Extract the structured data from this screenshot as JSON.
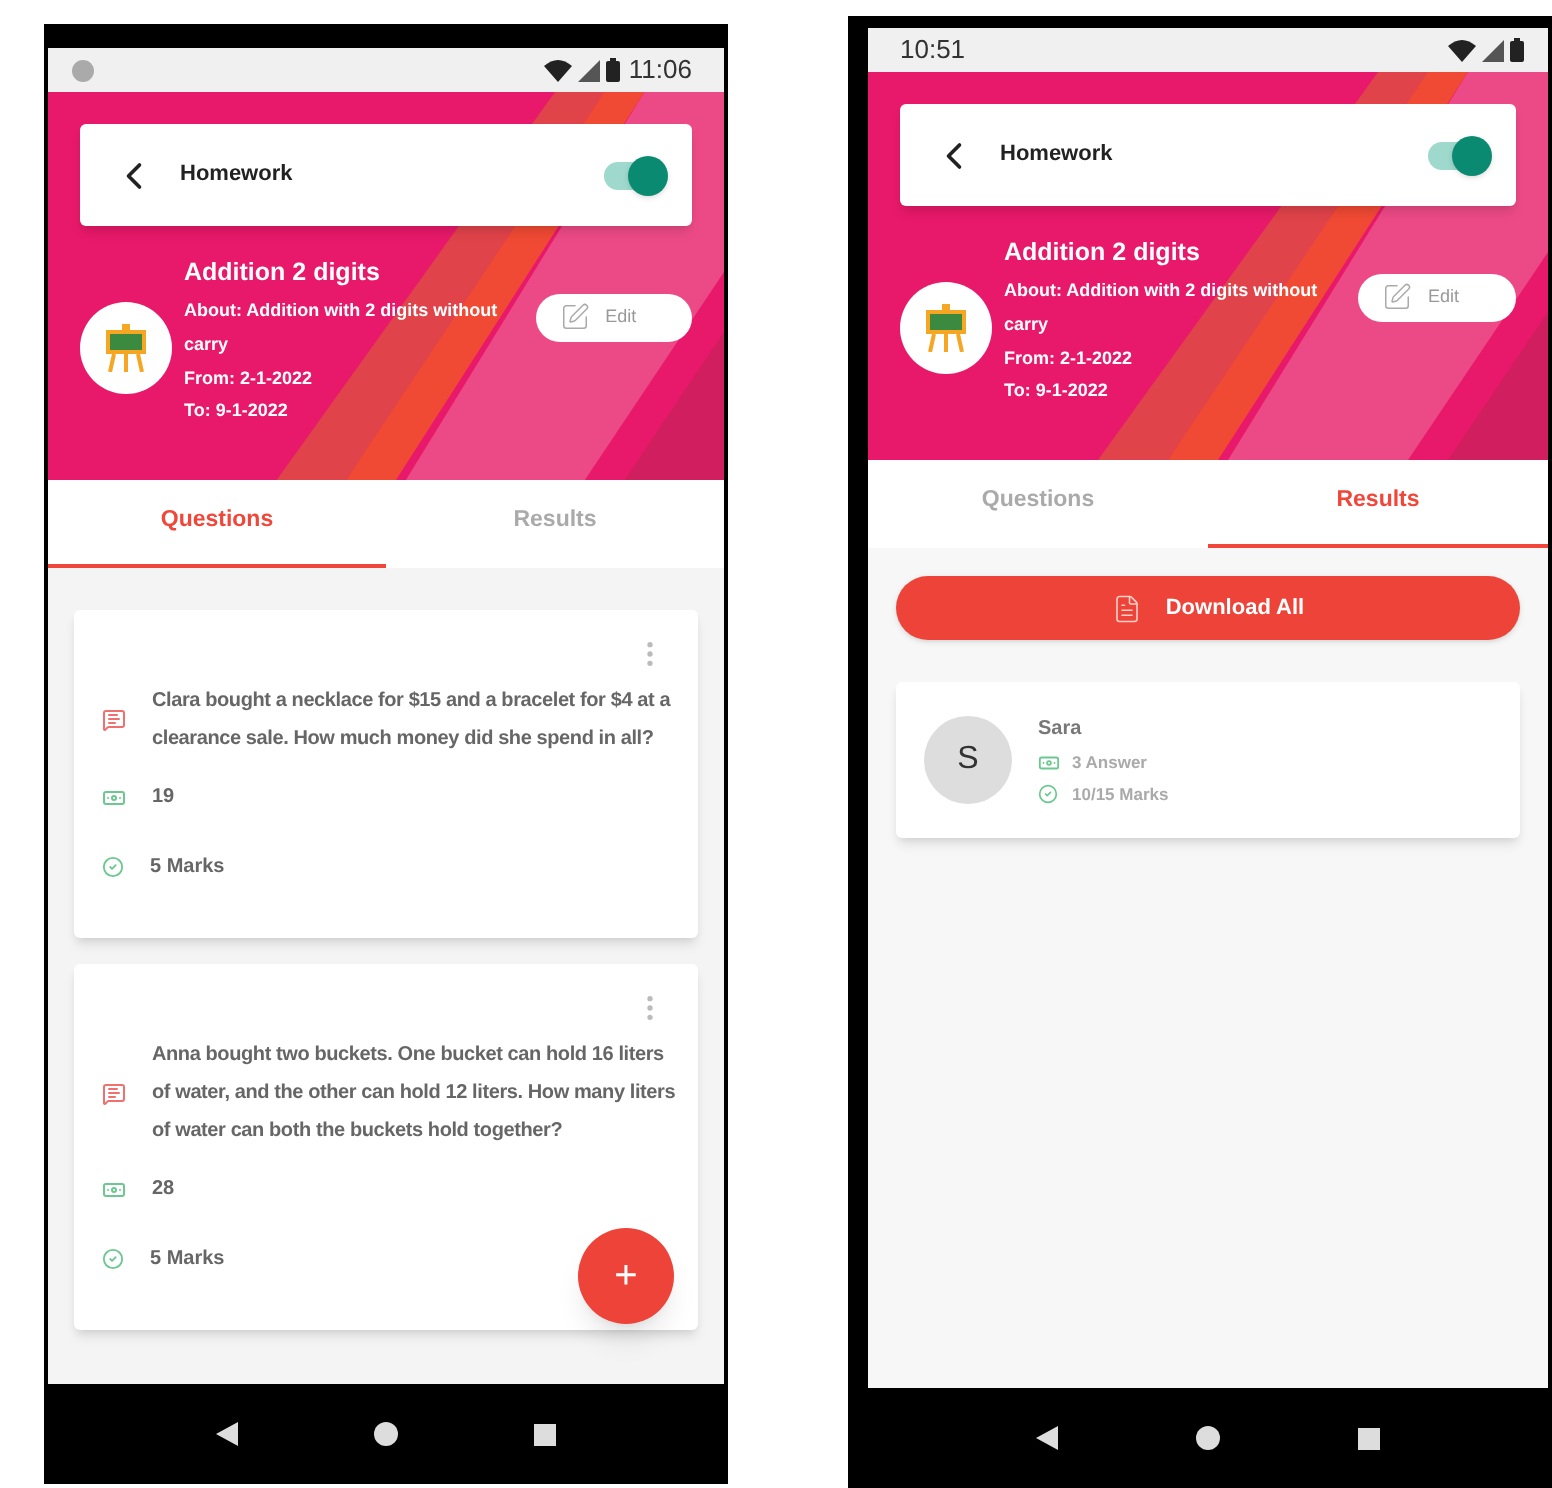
{
  "phones": [
    {
      "status_bar": {
        "items": [
          {
            "kind": "dot"
          },
          {
            "kind": "spacer"
          },
          {
            "kind": "icons"
          },
          {
            "kind": "time",
            "text": "11:06"
          }
        ]
      },
      "header": {
        "title": "Homework",
        "toggle": {
          "on": true
        }
      },
      "assignment": {
        "title": "Addition 2 digits",
        "about": "About: Addition with 2 digits without carry",
        "from": "From: 2-1-2022",
        "to": "To: 9-1-2022",
        "edit_button": "Edit"
      },
      "tabs": [
        {
          "label": "Questions",
          "selected": true
        },
        {
          "label": "Results",
          "selected": false
        }
      ],
      "content": {
        "kind": "questions",
        "questions": [
          {
            "text": "Clara bought a necklace for $15 and a bracelet for $4 at a clearance sale. How much money did she spend in all?",
            "answer": "19",
            "marks": "5 Marks"
          },
          {
            "text": "Anna bought two buckets. One bucket can hold 16 liters of water, and the other can hold 12 liters. How many liters of water can both the buckets hold together?",
            "answer": "28",
            "marks": "5 Marks"
          }
        ],
        "fab": "+"
      }
    },
    {
      "status_bar": {
        "items": [
          {
            "kind": "time",
            "text": "10:51"
          },
          {
            "kind": "spacer"
          },
          {
            "kind": "icons"
          }
        ]
      },
      "header": {
        "title": "Homework",
        "toggle": {
          "on": true
        }
      },
      "assignment": {
        "title": "Addition 2 digits",
        "about": "About: Addition with 2 digits without carry",
        "from": "From: 2-1-2022",
        "to": "To: 9-1-2022",
        "edit_button": "Edit"
      },
      "tabs": [
        {
          "label": "Questions",
          "selected": false
        },
        {
          "label": "Results",
          "selected": true
        }
      ],
      "content": {
        "kind": "results",
        "download_button": "Download All",
        "students": [
          {
            "initial": "S",
            "name": "Sara",
            "answers": "3 Answer",
            "marks": "10/15 Marks"
          }
        ]
      }
    }
  ]
}
